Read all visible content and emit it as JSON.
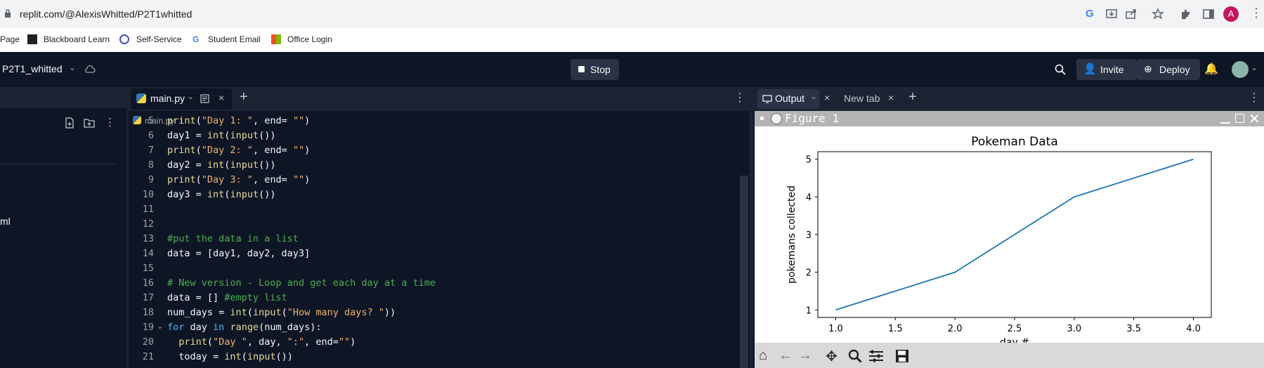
{
  "browser": {
    "url": "replit.com/@AlexisWhitted/P2T1whitted",
    "profile_initial": "A",
    "bookmarks": [
      {
        "label": "Page"
      },
      {
        "label": "Blackboard Learn"
      },
      {
        "label": "Self-Service"
      },
      {
        "label": "Student Email"
      },
      {
        "label": "Office Login"
      }
    ]
  },
  "header": {
    "project_name": "P2T1_whitted",
    "stop_label": "Stop",
    "invite_label": "Invite",
    "deploy_label": "Deploy"
  },
  "sidebar": {
    "file_label": "ml"
  },
  "editor": {
    "tab_label": "main.py",
    "breadcrumb_file": "main.py",
    "breadcrumb_rest": "...",
    "lines": [
      {
        "n": "5",
        "code": "print(\"Day 1: \", end= \"\")"
      },
      {
        "n": "6",
        "code": "day1 = int(input())"
      },
      {
        "n": "7",
        "code": "print(\"Day 2: \", end= \"\")"
      },
      {
        "n": "8",
        "code": "day2 = int(input())"
      },
      {
        "n": "9",
        "code": "print(\"Day 3: \", end= \"\")"
      },
      {
        "n": "10",
        "code": "day3 = int(input())"
      },
      {
        "n": "11",
        "code": ""
      },
      {
        "n": "12",
        "code": ""
      },
      {
        "n": "13",
        "code": "#put the data in a list"
      },
      {
        "n": "14",
        "code": "data = [day1, day2, day3]"
      },
      {
        "n": "15",
        "code": ""
      },
      {
        "n": "16",
        "code": "# New version - Loop and get each day at a time"
      },
      {
        "n": "17",
        "code": "data = [] #empty list"
      },
      {
        "n": "18",
        "code": "num_days = int(input(\"How many days? \"))"
      },
      {
        "n": "19",
        "code": "for day in range(num_days):"
      },
      {
        "n": "20",
        "code": "  print(\"Day \", day, \":\", end=\"\")"
      },
      {
        "n": "21",
        "code": "  today = int(input())"
      }
    ]
  },
  "output_panel": {
    "output_tab_label": "Output",
    "new_tab_label": "New tab",
    "figure_title": "Figure 1"
  },
  "chart_data": {
    "type": "line",
    "title": "Pokeman Data",
    "xlabel": "day #",
    "ylabel": "pokemans collected",
    "x": [
      1.0,
      2.0,
      3.0,
      4.0
    ],
    "series": [
      {
        "values": [
          1,
          2,
          4,
          5
        ],
        "color": "#1f77b4"
      }
    ],
    "xlim": [
      0.85,
      4.15
    ],
    "ylim": [
      0.8,
      5.2
    ],
    "xticks": [
      "1.0",
      "1.5",
      "2.0",
      "2.5",
      "3.0",
      "3.5",
      "4.0"
    ],
    "yticks": [
      "1",
      "2",
      "3",
      "4",
      "5"
    ],
    "grid": false
  },
  "colors": {
    "accent_blue": "#1f77b4",
    "replit_bg": "#0e1525",
    "panel_bg": "#1c2333"
  }
}
